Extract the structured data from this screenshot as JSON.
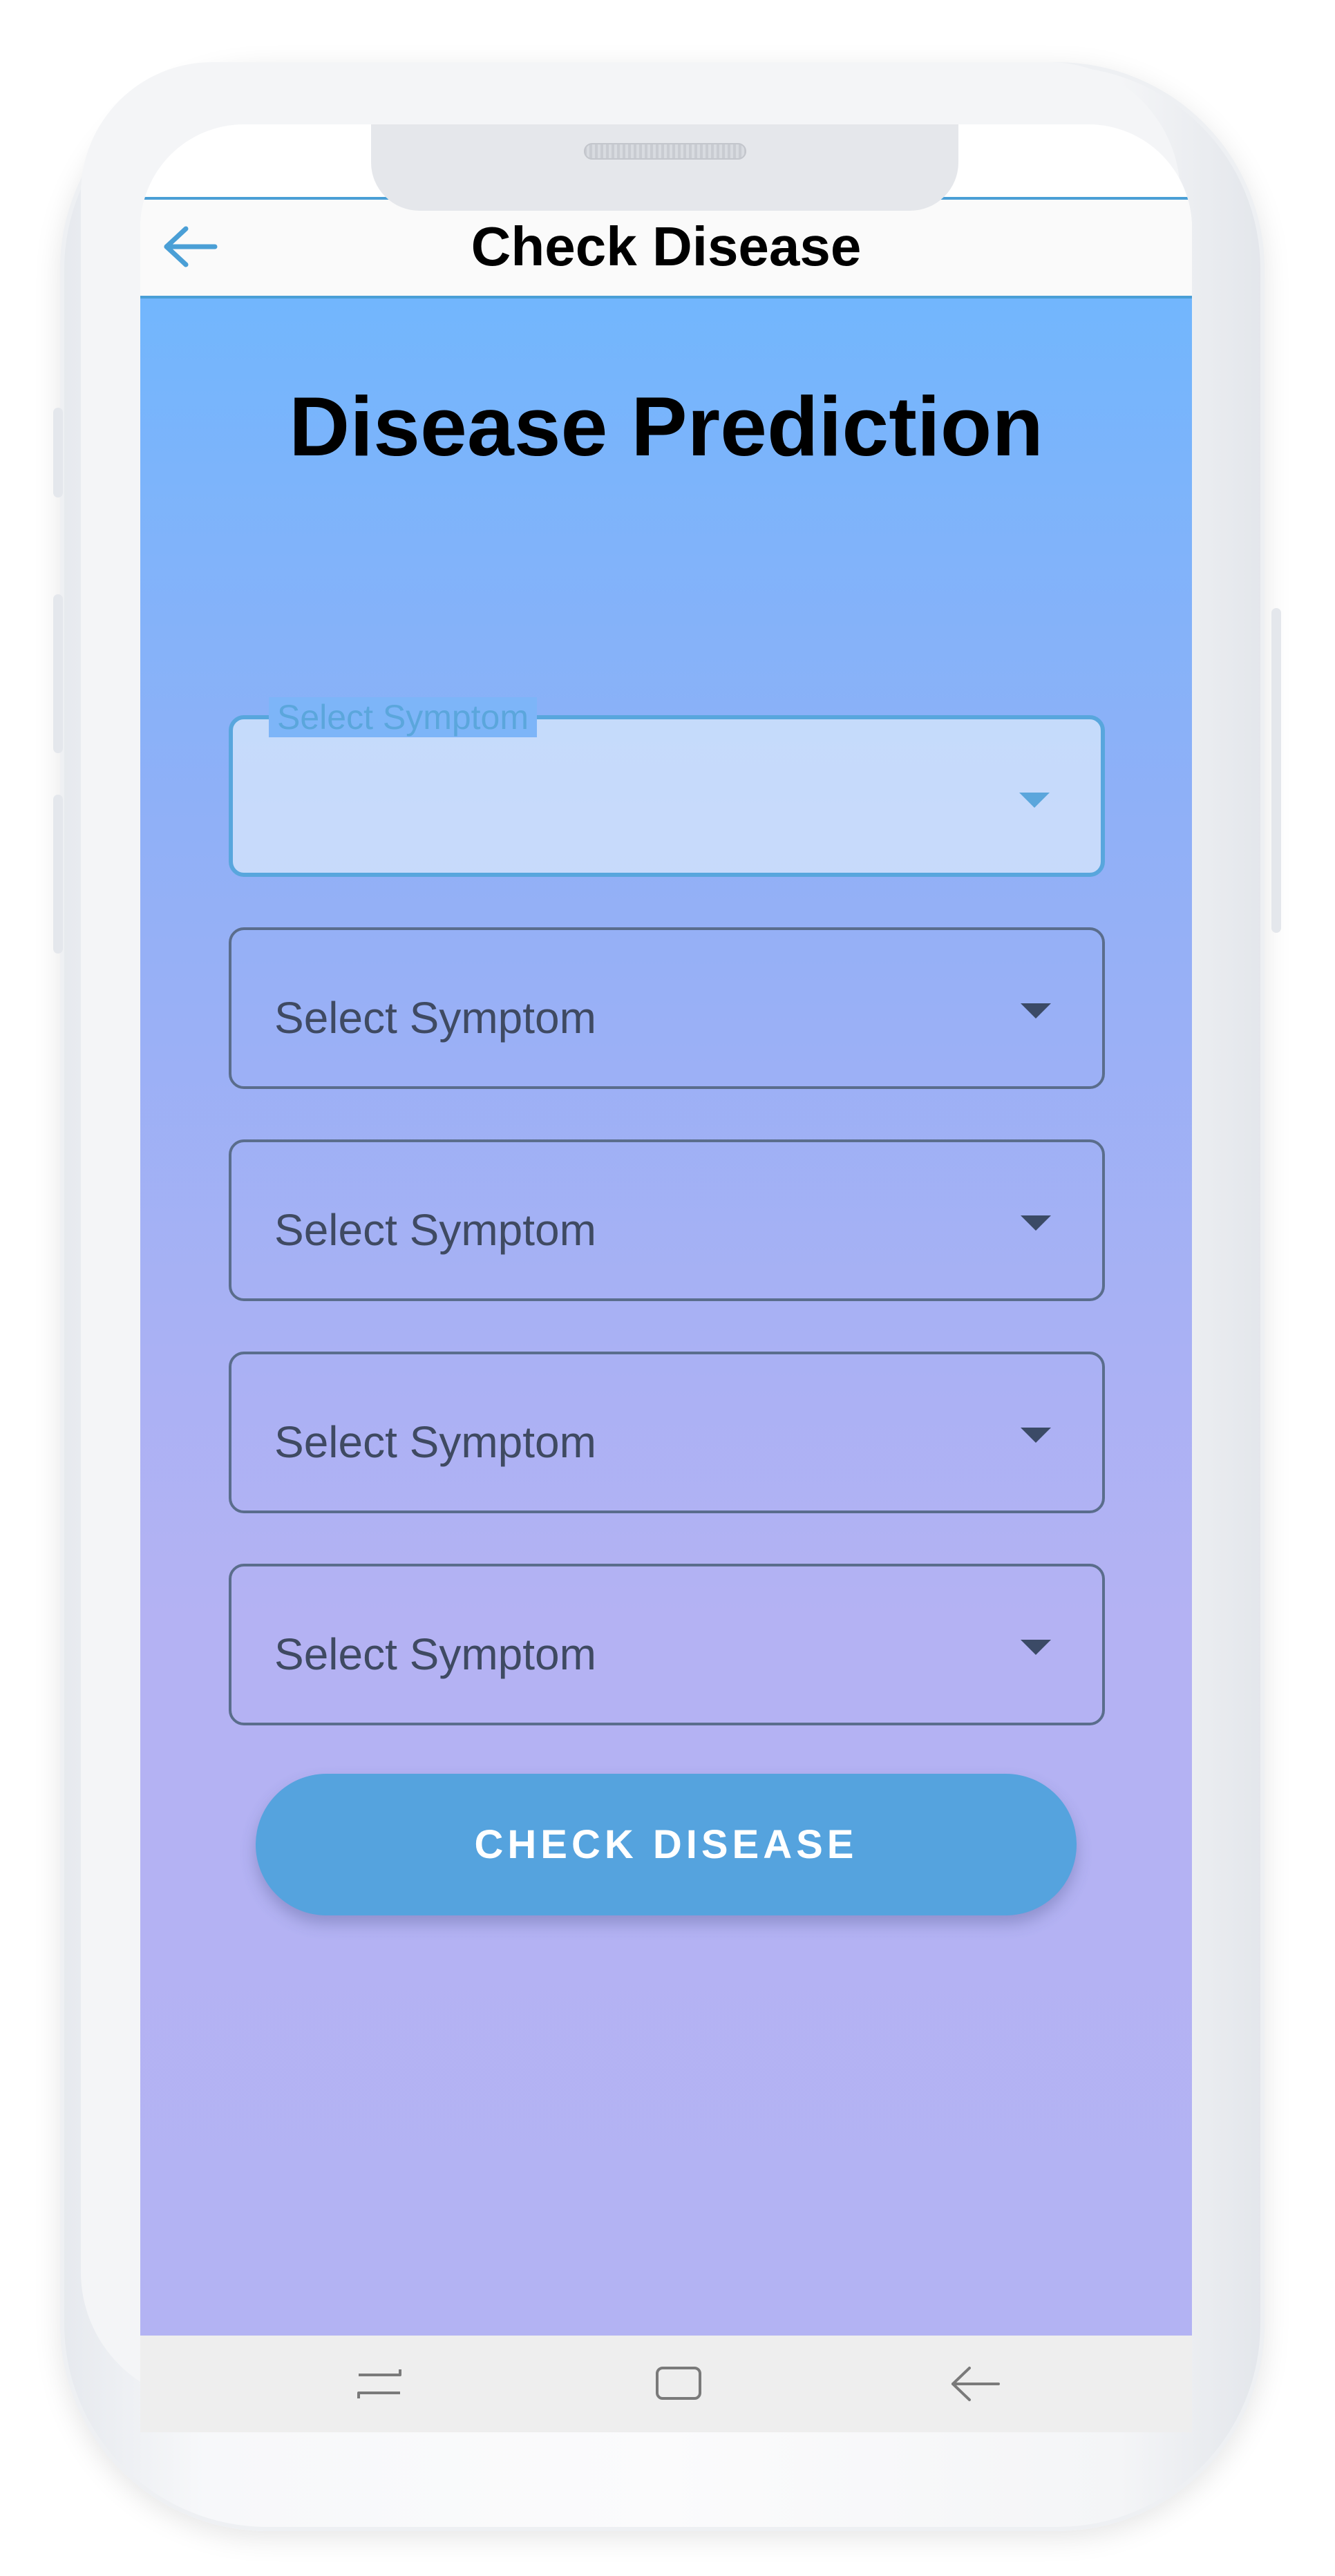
{
  "appbar": {
    "title": "Check Disease",
    "back_icon": "arrow-left-icon"
  },
  "main": {
    "heading": "Disease Prediction",
    "dropdowns": [
      {
        "label": "Select Symptom",
        "state": "focused",
        "value": ""
      },
      {
        "label": "Select Symptom",
        "state": "idle",
        "value": ""
      },
      {
        "label": "Select Symptom",
        "state": "idle",
        "value": ""
      },
      {
        "label": "Select Symptom",
        "state": "idle",
        "value": ""
      },
      {
        "label": "Select Symptom",
        "state": "idle",
        "value": ""
      }
    ],
    "check_button_label": "CHECK DISEASE"
  },
  "navbar": {
    "icons": [
      "recent-apps-icon",
      "home-icon",
      "back-icon"
    ]
  },
  "colors": {
    "accent": "#55a3de",
    "gradient_top": "#72b6fd",
    "gradient_bottom": "#b3b3f3"
  }
}
